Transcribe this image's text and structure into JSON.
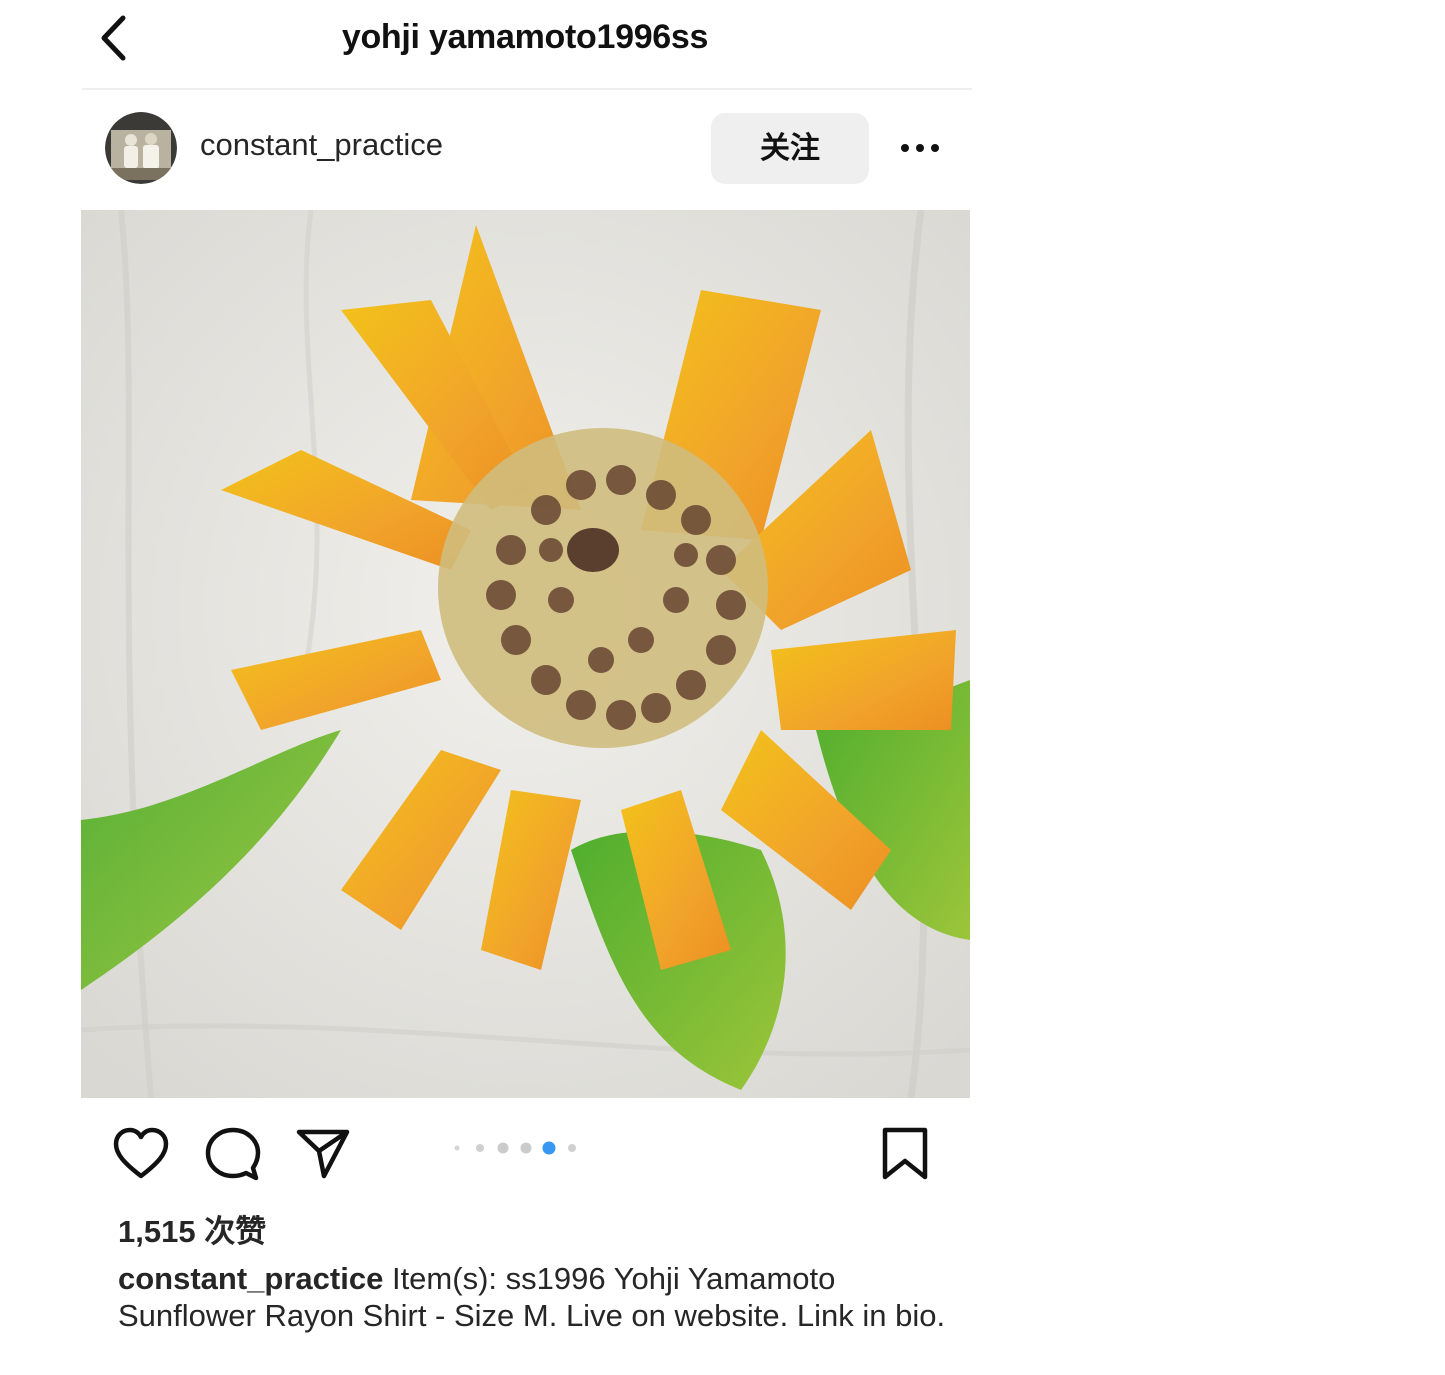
{
  "header": {
    "title": "yohji yamamoto1996ss",
    "back_icon": "chevron-left-icon"
  },
  "post": {
    "username": "constant_practice",
    "follow_label": "关注",
    "more_icon": "more-horizontal-icon",
    "image_alt": "Hand-painted sunflower on white rayon shirt",
    "carousel": {
      "count": 6,
      "active_index": 4
    },
    "actions": {
      "like_icon": "heart-icon",
      "comment_icon": "comment-bubble-icon",
      "share_icon": "paper-plane-icon",
      "save_icon": "bookmark-icon"
    },
    "likes": "1,515 次赞",
    "caption_username": "constant_practice",
    "caption_text": "Item(s): ss1996 Yohji Yamamoto Sunflower Rayon Shirt - Size M. Live on website. Link in bio."
  },
  "colors": {
    "accent_blue": "#3897f0",
    "button_gray": "#efefef",
    "text": "#262626"
  }
}
